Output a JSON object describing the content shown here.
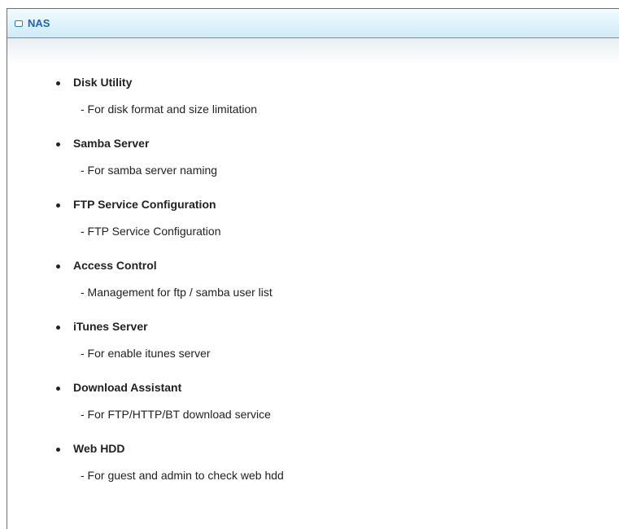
{
  "panel": {
    "title": "NAS",
    "icon": "window-icon"
  },
  "items": [
    {
      "title": "Disk Utility",
      "desc": "- For disk format and size limitation"
    },
    {
      "title": "Samba Server",
      "desc": "- For samba server naming"
    },
    {
      "title": "FTP Service Configuration",
      "desc": "- FTP Service Configuration"
    },
    {
      "title": "Access Control",
      "desc": "- Management for ftp / samba user list"
    },
    {
      "title": "iTunes Server",
      "desc": "- For enable itunes server"
    },
    {
      "title": "Download Assistant",
      "desc": "- For FTP/HTTP/BT download service"
    },
    {
      "title": "Web HDD",
      "desc": "- For guest and admin to check web hdd"
    }
  ],
  "colors": {
    "title_blue": "#1f63b4",
    "text": "#222222",
    "header_bg": "#dff2fb"
  }
}
